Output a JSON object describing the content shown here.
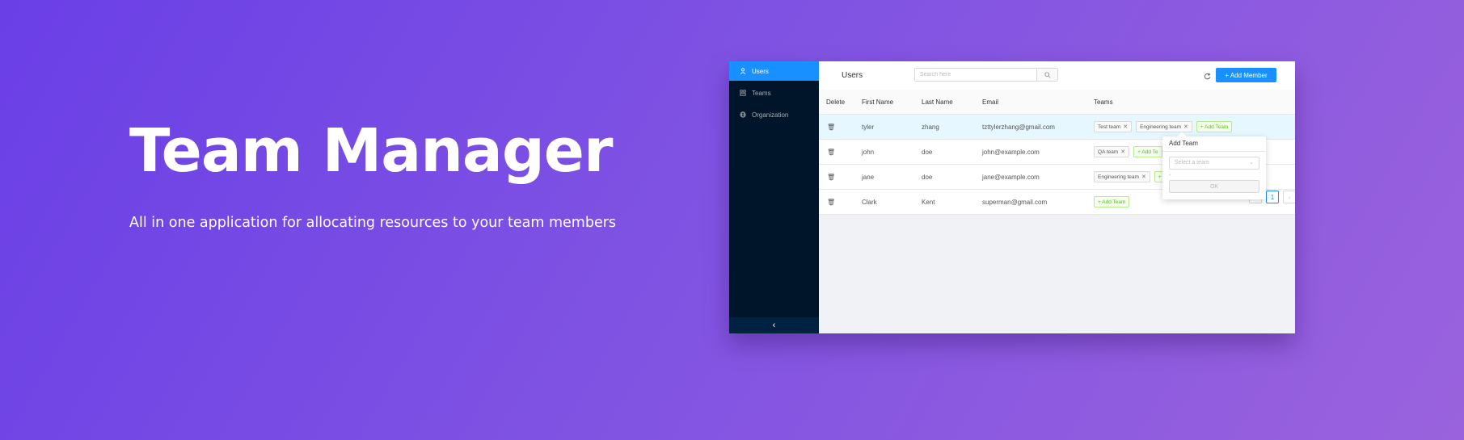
{
  "hero": {
    "title": "Team Manager",
    "subtitle": "All in one application for allocating resources to your team members"
  },
  "sidebar": {
    "items": [
      {
        "label": "Users",
        "icon": "user-icon",
        "active": true
      },
      {
        "label": "Teams",
        "icon": "team-icon",
        "active": false
      },
      {
        "label": "Organization",
        "icon": "globe-icon",
        "active": false
      }
    ],
    "collapse_icon": "‹"
  },
  "header": {
    "title": "Users",
    "search_placeholder": "Search here",
    "add_member_label": "+ Add Member"
  },
  "table": {
    "columns": [
      "Delete",
      "First Name",
      "Last Name",
      "Email",
      "Teams"
    ],
    "rows": [
      {
        "first": "tyler",
        "last": "zhang",
        "email": "tzttylerzhang@gmail.com",
        "teams": [
          "Test team",
          "Engineering team"
        ],
        "add": "+ Add Team",
        "highlighted": true
      },
      {
        "first": "john",
        "last": "doe",
        "email": "john@example.com",
        "teams": [
          "QA team"
        ],
        "add": "+ Add Te"
      },
      {
        "first": "jane",
        "last": "doe",
        "email": "jane@example.com",
        "teams": [
          "Engineering team"
        ],
        "add": "+"
      },
      {
        "first": "Clark",
        "last": "Kent",
        "email": "superman@gmail.com",
        "teams": [],
        "add": "+ Add Team"
      }
    ],
    "delete_icon": "trash-icon"
  },
  "popover": {
    "title": "Add Team",
    "select_placeholder": "Select a team",
    "ok_label": "OK"
  },
  "pagination": {
    "prev": "‹",
    "current": "1",
    "next": "›"
  },
  "colors": {
    "primary": "#1890ff",
    "sider_bg": "#001529",
    "tag_add": "#52c41a"
  }
}
